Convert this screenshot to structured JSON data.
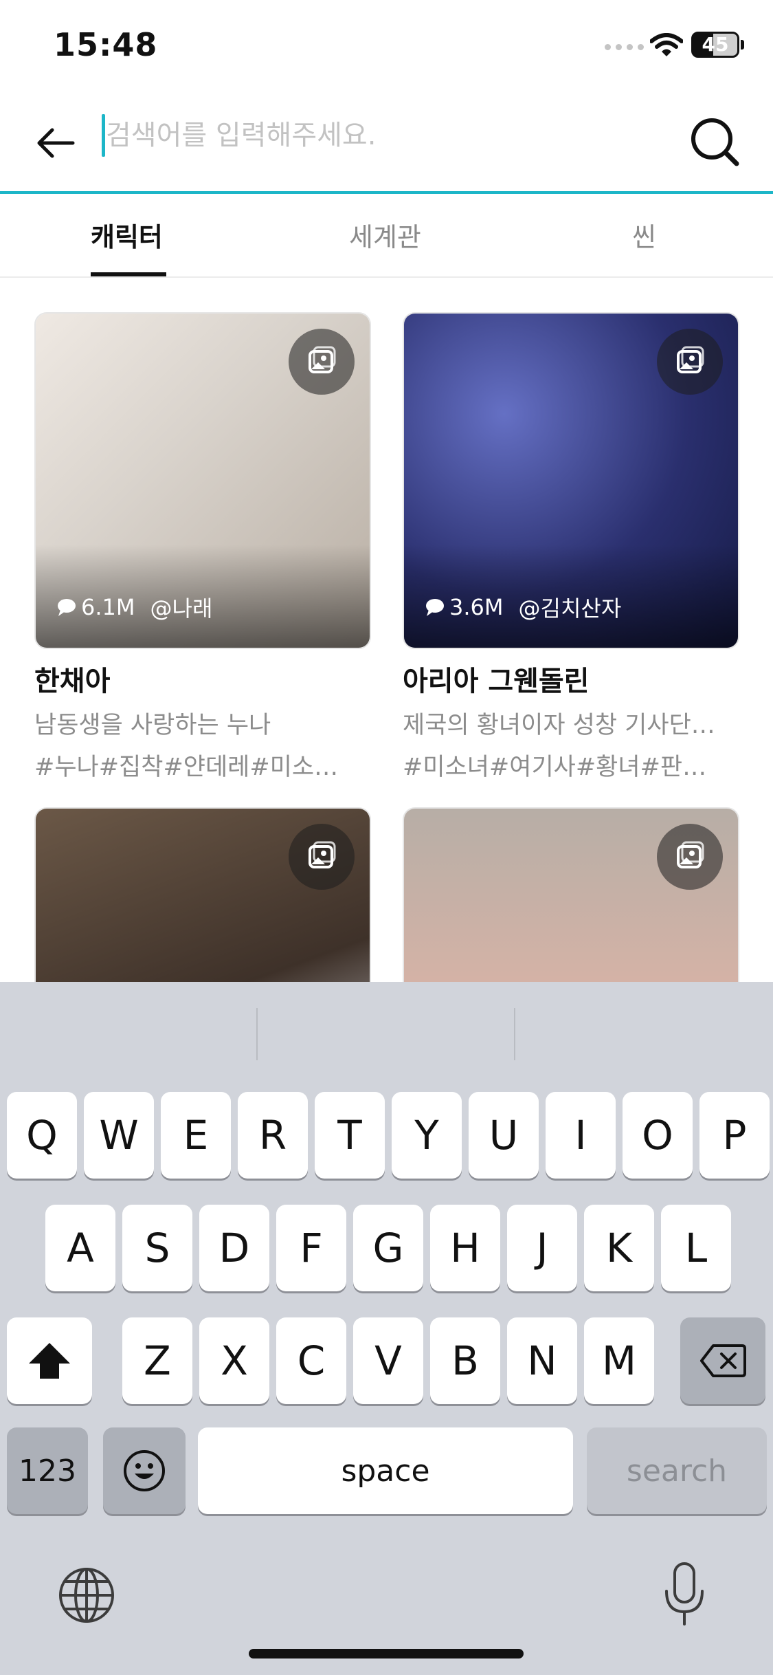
{
  "status_bar": {
    "time": "15:48",
    "battery": "45"
  },
  "search": {
    "placeholder": "검색어를 입력해주세요.",
    "value": ""
  },
  "tabs": [
    {
      "label": "캐릭터",
      "active": true
    },
    {
      "label": "세계관",
      "active": false
    },
    {
      "label": "씬",
      "active": false
    }
  ],
  "cards": [
    {
      "chats": "6.1M",
      "author": "@나래",
      "title": "한채아",
      "description": "남동생을 사랑하는 누나",
      "tags": "#누나#집착#얀데레#미소…"
    },
    {
      "chats": "3.6M",
      "author": "@김치산자",
      "title": "아리아 그웬돌린",
      "description": "제국의 황녀이자 성창 기사단…",
      "tags": "#미소녀#여기사#황녀#판…"
    },
    {
      "chats": "",
      "author": "",
      "title": "",
      "description": "",
      "tags": ""
    },
    {
      "chats": "",
      "author": "",
      "title": "",
      "description": "",
      "tags": ""
    }
  ],
  "keyboard": {
    "row1": [
      "Q",
      "W",
      "E",
      "R",
      "T",
      "Y",
      "U",
      "I",
      "O",
      "P"
    ],
    "row2": [
      "A",
      "S",
      "D",
      "F",
      "G",
      "H",
      "J",
      "K",
      "L"
    ],
    "row3": [
      "Z",
      "X",
      "C",
      "V",
      "B",
      "N",
      "M"
    ],
    "numbers_label": "123",
    "space_label": "space",
    "search_label": "search"
  },
  "colors": {
    "accent": "#1db6c8",
    "keyboard_bg": "#d1d4db"
  },
  "icons": [
    "back-arrow-icon",
    "search-icon",
    "image-gallery-icon",
    "chat-bubble-icon",
    "shift-icon",
    "backspace-icon",
    "emoji-icon",
    "globe-icon",
    "microphone-icon"
  ]
}
